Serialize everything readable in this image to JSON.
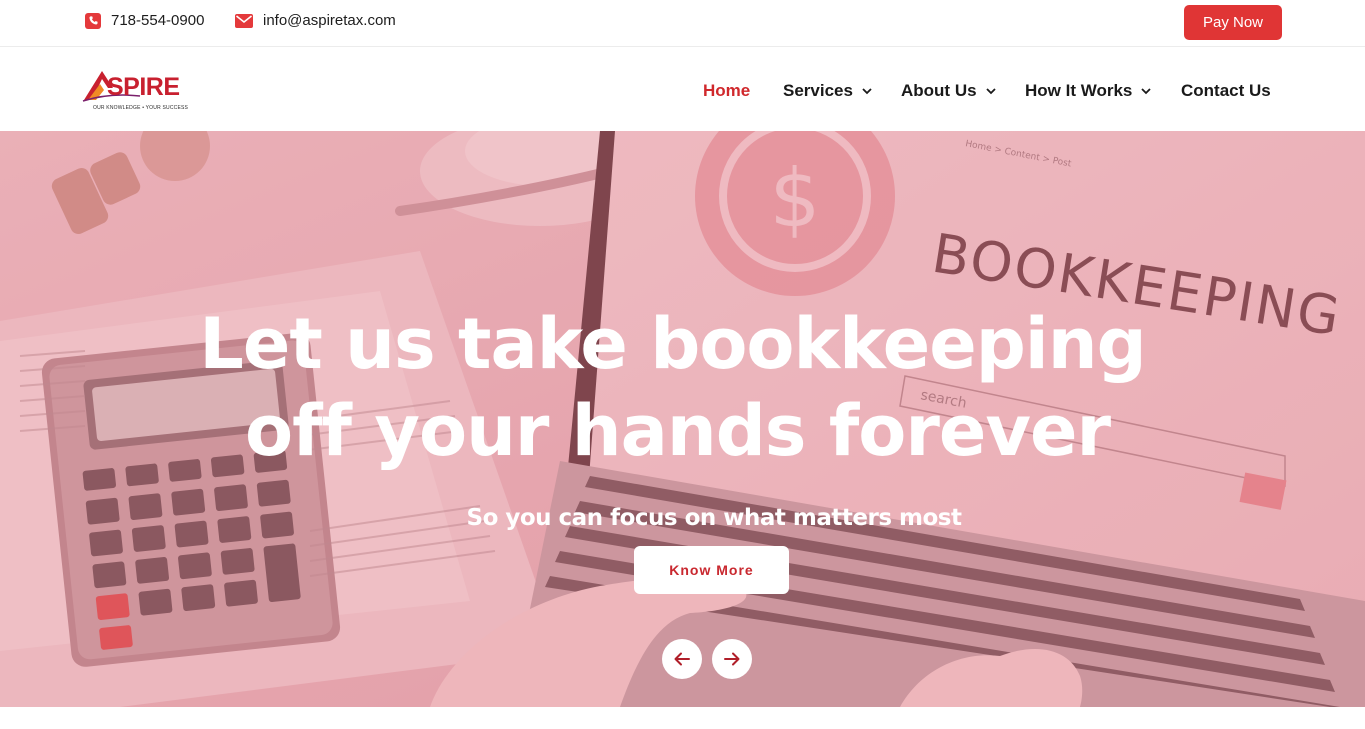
{
  "topbar": {
    "phone": "718-554-0900",
    "email": "info@aspiretax.com",
    "pay_label": "Pay Now"
  },
  "logo": {
    "word": "ASPIRE",
    "tagline": "OUR KNOWLEDGE • YOUR SUCCESS"
  },
  "nav": {
    "items": [
      {
        "label": "Home",
        "active": true,
        "dropdown": false
      },
      {
        "label": "Services",
        "active": false,
        "dropdown": true
      },
      {
        "label": "About Us",
        "active": false,
        "dropdown": true
      },
      {
        "label": "How It Works",
        "active": false,
        "dropdown": true
      },
      {
        "label": "Contact Us",
        "active": false,
        "dropdown": false
      }
    ]
  },
  "hero": {
    "headline_line1": "Let us take bookkeeping",
    "headline_line2": "off your hands forever",
    "subheadline": "So you can focus on what matters most",
    "cta_label": "Know More",
    "screen_word": "BOOKKEEPING",
    "screen_search": "search",
    "screen_breadcrumb": "Home > Content > Post",
    "screen_symbol": "$"
  },
  "colors": {
    "accent": "#e03535",
    "brand_red": "#c8202f",
    "nav_active": "#d0282c",
    "hero_tint": "#e9b7bd"
  },
  "icons": [
    "phone-icon",
    "mail-icon",
    "chevron-down-icon",
    "arrow-left-icon",
    "arrow-right-icon"
  ]
}
